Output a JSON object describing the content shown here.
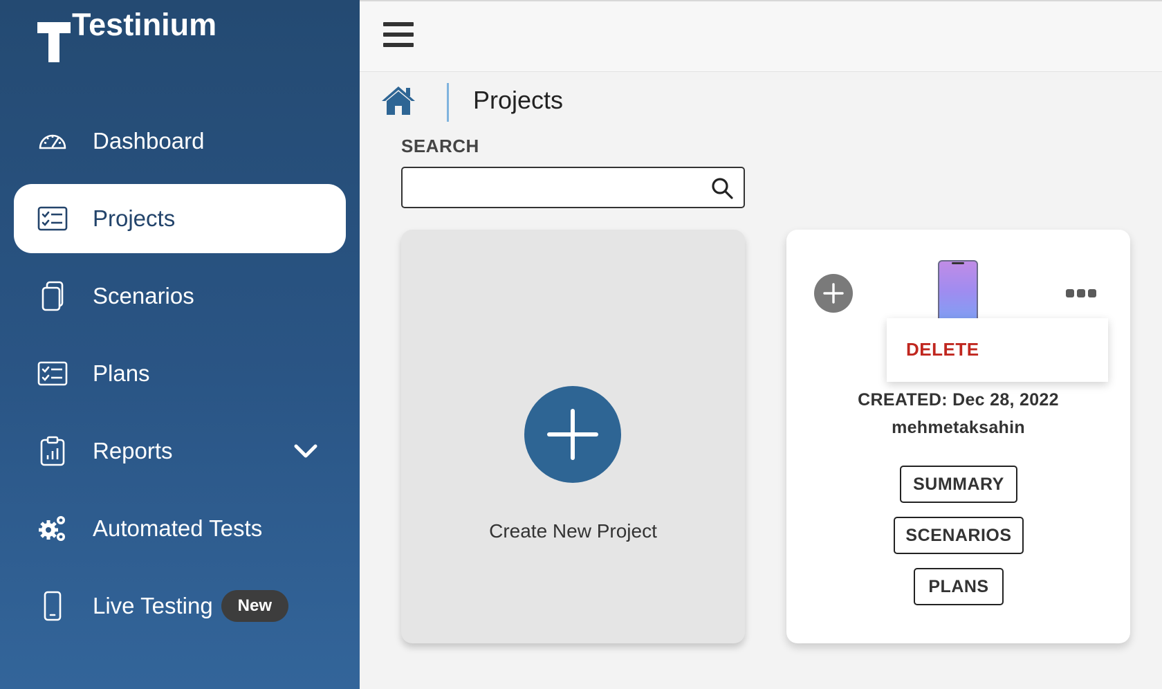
{
  "app": {
    "name": "Testinium"
  },
  "sidebar": {
    "items": [
      {
        "label": "Dashboard",
        "icon": "gauge-icon"
      },
      {
        "label": "Projects",
        "icon": "checklist-icon",
        "active": true
      },
      {
        "label": "Scenarios",
        "icon": "copy-icon"
      },
      {
        "label": "Plans",
        "icon": "checklist-icon"
      },
      {
        "label": "Reports",
        "icon": "report-clipboard-icon",
        "expandable": true
      },
      {
        "label": "Automated Tests",
        "icon": "gears-icon"
      },
      {
        "label": "Live Testing",
        "icon": "mobile-phone-icon",
        "badge": "New"
      }
    ]
  },
  "breadcrumb": {
    "title": "Projects"
  },
  "search": {
    "label": "SEARCH",
    "value": "",
    "placeholder": ""
  },
  "create_card": {
    "label": "Create New Project"
  },
  "project_card": {
    "created_label": "CREATED: Dec 28, 2022",
    "owner": "mehmetaksahin",
    "menu": {
      "delete_label": "DELETE"
    },
    "buttons": {
      "summary": "SUMMARY",
      "scenarios": "SCENARIOS",
      "plans": "PLANS"
    }
  },
  "colors": {
    "sidebar": "#2a5585",
    "accent": "#2e6594",
    "danger": "#c0271f"
  }
}
